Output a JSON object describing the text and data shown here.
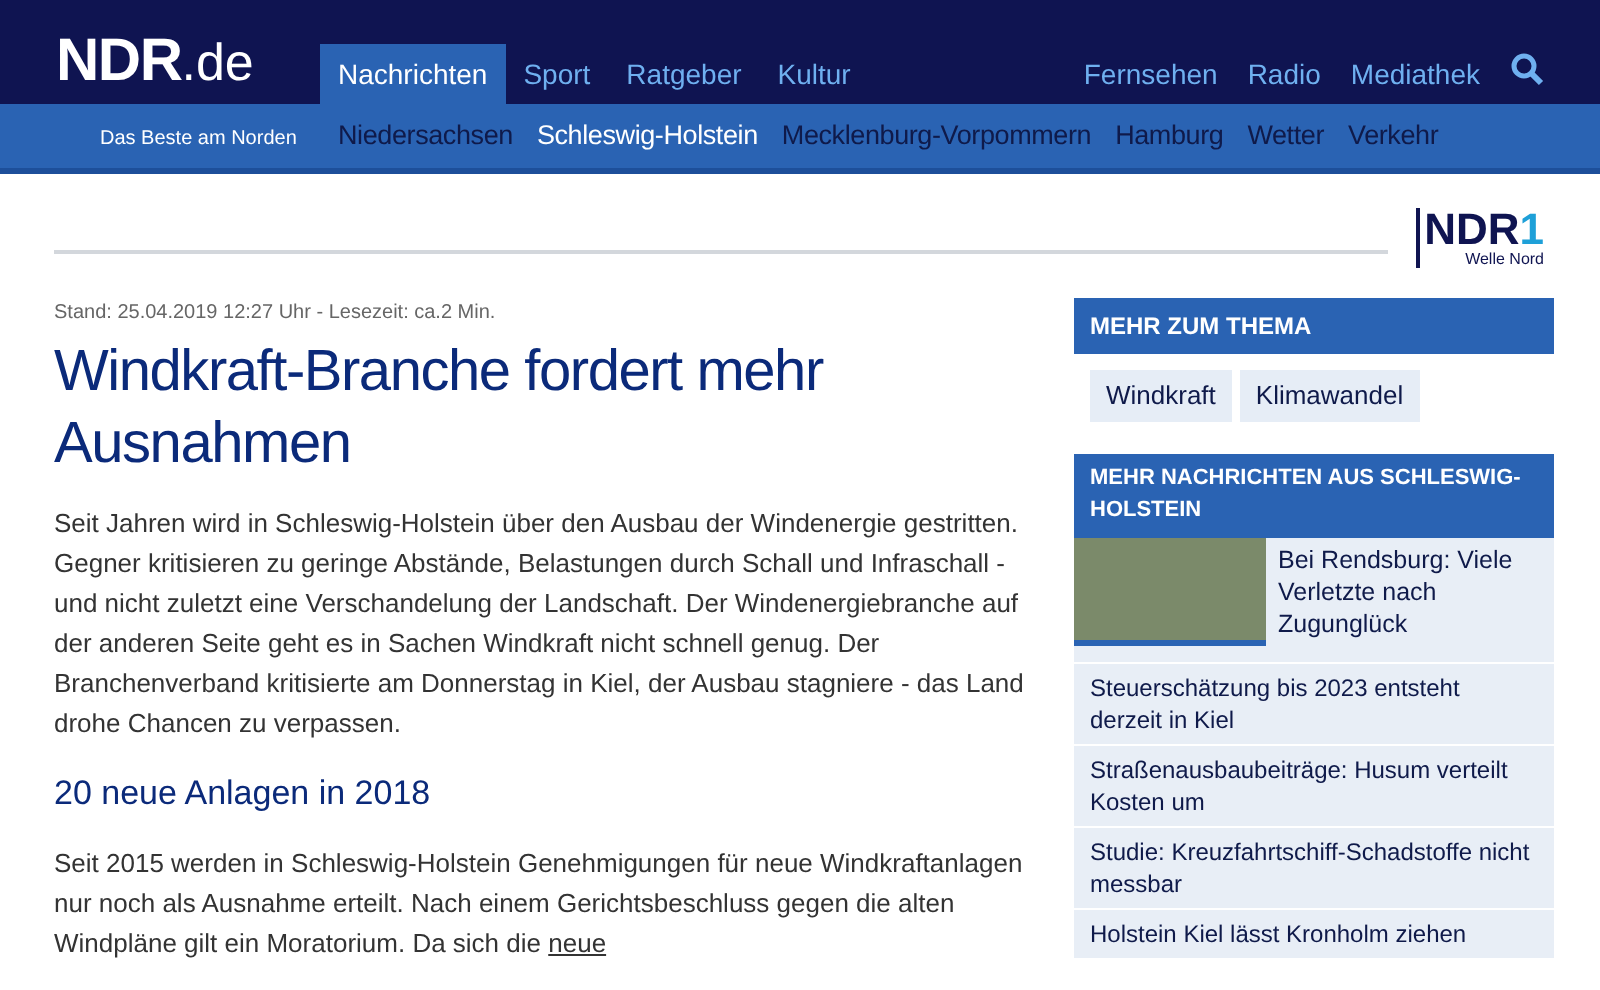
{
  "logo": {
    "wordmark": "NDR",
    "suffix": ".de",
    "tagline": "Das Beste am Norden"
  },
  "main_nav": [
    {
      "label": "Nachrichten",
      "selected": true
    },
    {
      "label": "Sport",
      "selected": false
    },
    {
      "label": "Ratgeber",
      "selected": false
    },
    {
      "label": "Kultur",
      "selected": false
    }
  ],
  "right_nav": [
    "Fernsehen",
    "Radio",
    "Mediathek"
  ],
  "sub_nav": [
    {
      "label": "Niedersachsen",
      "selected": false
    },
    {
      "label": "Schleswig-Holstein",
      "selected": true
    },
    {
      "label": "Mecklenburg-Vorpommern",
      "selected": false
    },
    {
      "label": "Hamburg",
      "selected": false
    },
    {
      "label": "Wetter",
      "selected": false
    },
    {
      "label": "Verkehr",
      "selected": false
    }
  ],
  "station_logo": {
    "name": "NDR",
    "number": "1",
    "subtitle": "Welle Nord"
  },
  "article": {
    "meta": "Stand: 25.04.2019 12:27 Uhr - Lesezeit: ca.2 Min.",
    "title": "Windkraft-Branche fordert mehr Ausnahmen",
    "blocks": [
      {
        "kind": "paragraph",
        "text": "Seit Jahren wird in Schleswig-Holstein über den Ausbau der Windenergie gestritten. Gegner kritisieren zu geringe Abstände, Belastungen durch Schall und Infraschall - und nicht zuletzt eine Verschandelung der Landschaft. Der Windenergiebranche auf der anderen Seite geht es in Sachen Windkraft nicht schnell genug. Der Branchenverband kritisierte am Donnerstag in Kiel, der Ausbau stagniere - das Land drohe Chancen zu verpassen."
      },
      {
        "kind": "heading",
        "text": "20 neue Anlagen in 2018"
      },
      {
        "kind": "paragraph",
        "text": "Seit 2015 werden in Schleswig-Holstein Genehmigungen für neue Windkraftanlagen nur noch als Ausnahme erteilt. Nach einem Gerichtsbeschluss gegen die alten Windpläne gilt ein Moratorium. Da sich die",
        "link": "neue"
      }
    ]
  },
  "sidebar": {
    "topics": {
      "title": "MEHR ZUM THEMA",
      "tags": [
        "Windkraft",
        "Klimawandel"
      ]
    },
    "news": {
      "title": "MEHR NACHRICHTEN AUS SCHLESWIG-HOLSTEIN",
      "items": [
        {
          "kind": "teaser",
          "text": "Bei Rendsburg: Viele Verletzte nach Zugunglück"
        },
        {
          "kind": "link",
          "text": "Steuerschätzung bis 2023 entsteht derzeit in Kiel"
        },
        {
          "kind": "link",
          "text": "Straßenausbaubeiträge: Husum verteilt Kosten um"
        },
        {
          "kind": "link",
          "text": "Studie: Kreuzfahrtschiff-Schadstoffe nicht messbar"
        },
        {
          "kind": "link",
          "text": "Holstein Kiel lässt Kronholm ziehen"
        }
      ]
    }
  }
}
